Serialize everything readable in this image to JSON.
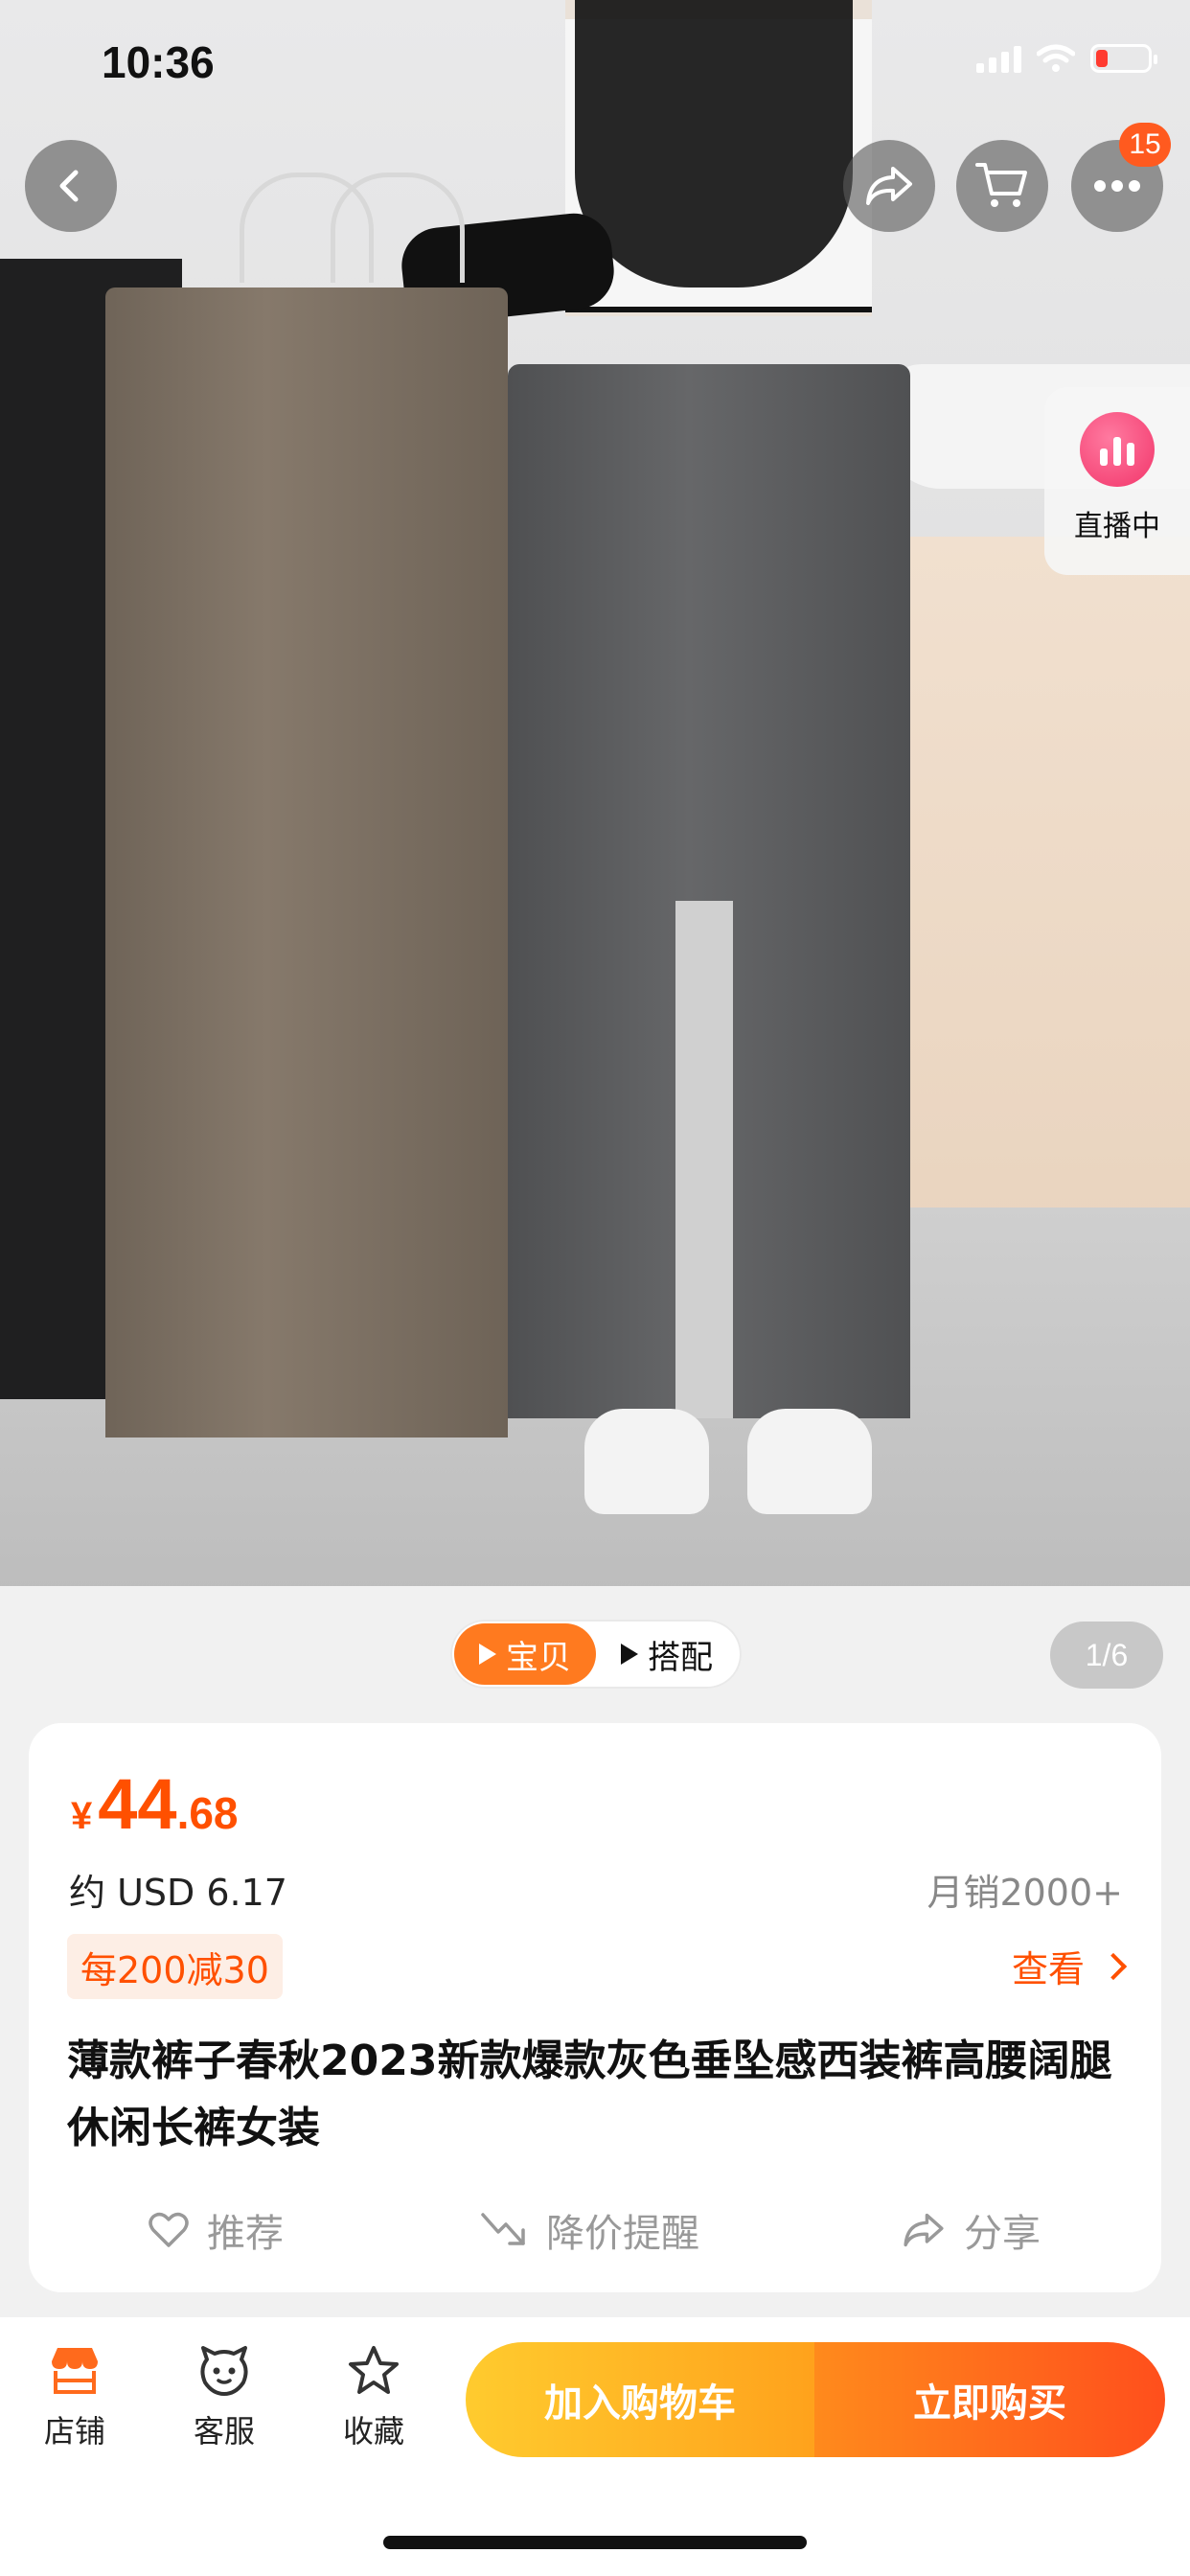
{
  "status_bar": {
    "time": "10:36"
  },
  "header": {
    "cart_badge": "15"
  },
  "live": {
    "label": "直播中"
  },
  "gallery": {
    "tabs": [
      {
        "label": "宝贝",
        "active": true
      },
      {
        "label": "搭配",
        "active": false
      }
    ],
    "page_indicator": "1/6"
  },
  "product": {
    "price": {
      "currency": "¥",
      "integer": "44",
      "decimal": ".68"
    },
    "usd_approx": "约 USD 6.17",
    "monthly_sales": "月销2000+",
    "coupon": "每200减30",
    "coupon_link": "查看",
    "title": "薄款裤子春秋2023新款爆款灰色垂坠感西装裤高腰阔腿休闲长裤女装",
    "actions": {
      "recommend": "推荐",
      "price_alert": "降价提醒",
      "share": "分享"
    }
  },
  "bottom_bar": {
    "store": "店铺",
    "service": "客服",
    "favorite": "收藏",
    "add_to_cart": "加入购物车",
    "buy_now": "立即购买"
  },
  "colors": {
    "accent": "#ff5000",
    "cart_button": "#ffb020",
    "buy_button": "#ff5a1c",
    "live": "#f2356a"
  }
}
